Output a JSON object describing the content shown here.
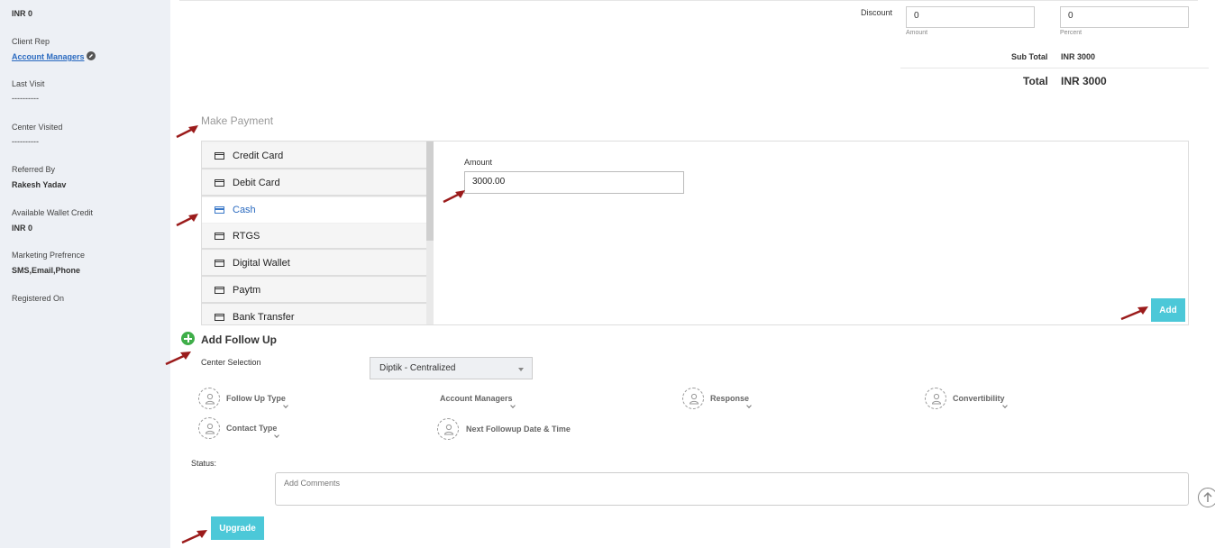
{
  "sidebar": {
    "balance_due_value": "INR 0",
    "client_rep_label": "Client Rep",
    "client_rep_link": "Account Managers",
    "last_visit_label": "Last Visit",
    "last_visit_value": "----------",
    "center_visited_label": "Center Visited",
    "center_visited_value": "----------",
    "referred_by_label": "Referred By",
    "referred_by_value": "Rakesh Yadav",
    "wallet_label": "Available Wallet Credit",
    "wallet_value": "INR 0",
    "marketing_label": "Marketing Prefrence",
    "marketing_value": "SMS,Email,Phone",
    "registered_label": "Registered On"
  },
  "summary": {
    "discount_label": "Discount",
    "discount_amount": "0",
    "discount_amount_sub": "Amount",
    "discount_percent": "0",
    "discount_percent_sub": "Percent",
    "subtotal_label": "Sub Total",
    "subtotal_value": "INR 3000",
    "total_label": "Total",
    "total_value": "INR 3000"
  },
  "payment": {
    "title": "Make Payment",
    "methods": [
      {
        "label": "Credit Card"
      },
      {
        "label": "Debit Card"
      },
      {
        "label": "Cash"
      },
      {
        "label": "RTGS"
      },
      {
        "label": "Digital Wallet"
      },
      {
        "label": "Paytm"
      },
      {
        "label": "Bank Transfer"
      }
    ],
    "active_method": "Cash",
    "amount_label": "Amount",
    "amount_value": "3000.00",
    "add_label": "Add"
  },
  "followup": {
    "title": "Add Follow Up",
    "center_label": "Center Selection",
    "center_value": "Diptik - Centralized",
    "fields": {
      "type": "Follow Up Type",
      "managers": "Account Managers",
      "response": "Response",
      "convertibility": "Convertibility",
      "contact_type": "Contact Type",
      "next_date": "Next Followup Date & Time"
    },
    "status_label": "Status:",
    "comments_placeholder": "Add Comments",
    "upgrade_label": "Upgrade"
  },
  "colors": {
    "accent": "#4cc8d8",
    "link": "#2a6ac0",
    "sidebar_bg": "#edf0f5",
    "annotation_arrow": "#9b1b1b",
    "add_icon": "#3fae49"
  }
}
